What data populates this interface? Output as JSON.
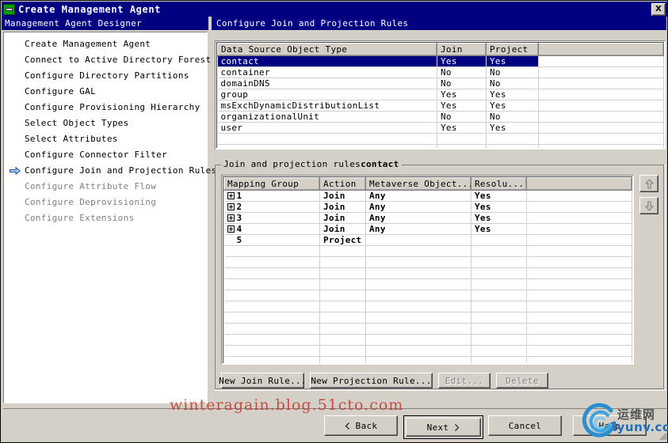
{
  "window": {
    "title": "Create Management Agent",
    "title_icon": "management-agent-icon",
    "close_label": "X"
  },
  "left_pane": {
    "header": "Management Agent Designer",
    "steps": [
      {
        "label": "Create Management Agent",
        "state": "normal",
        "current": false
      },
      {
        "label": "Connect to Active Directory Forest",
        "state": "normal",
        "current": false
      },
      {
        "label": "Configure Directory Partitions",
        "state": "normal",
        "current": false
      },
      {
        "label": "Configure GAL",
        "state": "normal",
        "current": false
      },
      {
        "label": "Configure Provisioning Hierarchy",
        "state": "normal",
        "current": false
      },
      {
        "label": "Select Object Types",
        "state": "normal",
        "current": false
      },
      {
        "label": "Select Attributes",
        "state": "normal",
        "current": false
      },
      {
        "label": "Configure Connector Filter",
        "state": "normal",
        "current": false
      },
      {
        "label": "Configure Join and Projection Rules",
        "state": "normal",
        "current": true
      },
      {
        "label": "Configure Attribute Flow",
        "state": "disabled",
        "current": false
      },
      {
        "label": "Configure Deprovisioning",
        "state": "disabled",
        "current": false
      },
      {
        "label": "Configure Extensions",
        "state": "disabled",
        "current": false
      }
    ]
  },
  "right_pane": {
    "header": "Configure Join and Projection Rules",
    "data_source_grid": {
      "columns": [
        "Data Source Object Type",
        "Join",
        "Project",
        ""
      ],
      "rows": [
        {
          "type": "contact",
          "join": "Yes",
          "project": "Yes",
          "selected": true
        },
        {
          "type": "container",
          "join": "No",
          "project": "No",
          "selected": false
        },
        {
          "type": "domainDNS",
          "join": "No",
          "project": "No",
          "selected": false
        },
        {
          "type": "group",
          "join": "Yes",
          "project": "Yes",
          "selected": false
        },
        {
          "type": "msExchDynamicDistributionList",
          "join": "Yes",
          "project": "Yes",
          "selected": false
        },
        {
          "type": "organizationalUnit",
          "join": "No",
          "project": "No",
          "selected": false
        },
        {
          "type": "user",
          "join": "Yes",
          "project": "Yes",
          "selected": false
        },
        {
          "type": "",
          "join": "",
          "project": "",
          "selected": false
        },
        {
          "type": "",
          "join": "",
          "project": "",
          "selected": false
        }
      ]
    },
    "rules_group": {
      "legend_prefix": "Join and projection rules",
      "legend_object": "contact",
      "columns": [
        "Mapping Group",
        "Action",
        "Metaverse Object...",
        "Resolu...",
        ""
      ],
      "rows": [
        {
          "group": "1",
          "expandable": true,
          "action": "Join",
          "metaverse": "Any",
          "resolution": "Yes"
        },
        {
          "group": "2",
          "expandable": true,
          "action": "Join",
          "metaverse": "Any",
          "resolution": "Yes"
        },
        {
          "group": "3",
          "expandable": true,
          "action": "Join",
          "metaverse": "Any",
          "resolution": "Yes"
        },
        {
          "group": "4",
          "expandable": true,
          "action": "Join",
          "metaverse": "Any",
          "resolution": "Yes"
        },
        {
          "group": "5",
          "expandable": false,
          "action": "Project",
          "metaverse": "",
          "resolution": ""
        },
        {
          "group": "",
          "expandable": false,
          "action": "",
          "metaverse": "",
          "resolution": ""
        },
        {
          "group": "",
          "expandable": false,
          "action": "",
          "metaverse": "",
          "resolution": ""
        },
        {
          "group": "",
          "expandable": false,
          "action": "",
          "metaverse": "",
          "resolution": ""
        },
        {
          "group": "",
          "expandable": false,
          "action": "",
          "metaverse": "",
          "resolution": ""
        },
        {
          "group": "",
          "expandable": false,
          "action": "",
          "metaverse": "",
          "resolution": ""
        },
        {
          "group": "",
          "expandable": false,
          "action": "",
          "metaverse": "",
          "resolution": ""
        },
        {
          "group": "",
          "expandable": false,
          "action": "",
          "metaverse": "",
          "resolution": ""
        },
        {
          "group": "",
          "expandable": false,
          "action": "",
          "metaverse": "",
          "resolution": ""
        },
        {
          "group": "",
          "expandable": false,
          "action": "",
          "metaverse": "",
          "resolution": ""
        },
        {
          "group": "",
          "expandable": false,
          "action": "",
          "metaverse": "",
          "resolution": ""
        },
        {
          "group": "",
          "expandable": false,
          "action": "",
          "metaverse": "",
          "resolution": ""
        }
      ],
      "move_up_icon": "arrow-up-icon",
      "move_down_icon": "arrow-down-icon",
      "buttons": {
        "new_join_rule": "New Join Rule...",
        "new_projection_rule": "New Projection Rule...",
        "edit": "Edit...",
        "delete": "Delete"
      }
    }
  },
  "nav": {
    "back": "Back",
    "next": "Next",
    "cancel": "Cancel",
    "help": "Help",
    "back_icon": "chevron-left-icon",
    "next_icon": "chevron-right-icon"
  },
  "overlay": {
    "watermark": "winteragain.blog.51cto.com",
    "logo_cn": "运维网",
    "logo_en": "iyunv.com",
    "logo_icon": "swirl-logo-icon"
  },
  "colors": {
    "titlebar": "#000080",
    "face": "#d4d0c8",
    "selection": "#000080",
    "watermark": "#c0392b",
    "logo_blue": "#1d6fb8"
  }
}
